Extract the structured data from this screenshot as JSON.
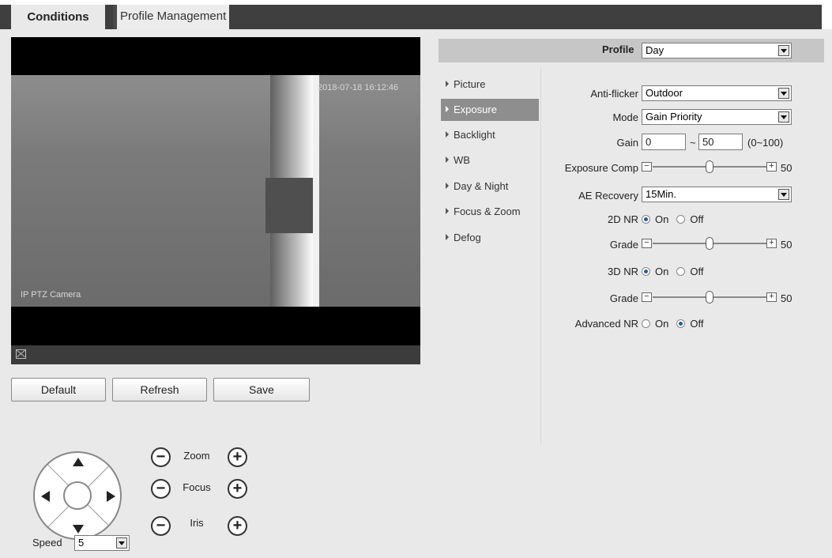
{
  "tabs": [
    {
      "label": "Conditions",
      "active": true
    },
    {
      "label": "Profile Management",
      "active": false
    }
  ],
  "video": {
    "timestamp": "2018-07-18 16:12:46",
    "camera_name": "IP PTZ Camera"
  },
  "actions": {
    "default_label": "Default",
    "refresh_label": "Refresh",
    "save_label": "Save"
  },
  "ptz": {
    "zoom_label": "Zoom",
    "focus_label": "Focus",
    "iris_label": "Iris",
    "minus_symbol": "−",
    "plus_symbol": "+",
    "speed_label": "Speed",
    "speed_value": "5"
  },
  "profile": {
    "label": "Profile",
    "value": "Day"
  },
  "menu": [
    {
      "label": "Picture",
      "active": false
    },
    {
      "label": "Exposure",
      "active": true
    },
    {
      "label": "Backlight",
      "active": false
    },
    {
      "label": "WB",
      "active": false
    },
    {
      "label": "Day & Night",
      "active": false
    },
    {
      "label": "Focus & Zoom",
      "active": false
    },
    {
      "label": "Defog",
      "active": false
    }
  ],
  "exposure": {
    "anti_flicker": {
      "label": "Anti-flicker",
      "value": "Outdoor"
    },
    "mode": {
      "label": "Mode",
      "value": "Gain Priority"
    },
    "gain": {
      "label": "Gain",
      "min": "0",
      "separator": "~",
      "max": "50",
      "range": "(0~100)"
    },
    "exposure_comp": {
      "label": "Exposure Comp",
      "value": "50",
      "level": 0.5
    },
    "ae_recovery": {
      "label": "AE Recovery",
      "value": "15Min."
    },
    "nr_2d": {
      "label": "2D NR",
      "on_label": "On",
      "off_label": "Off",
      "selected": "On"
    },
    "grade_2d": {
      "label": "Grade",
      "value": "50",
      "level": 0.5
    },
    "nr_3d": {
      "label": "3D NR",
      "on_label": "On",
      "off_label": "Off",
      "selected": "On"
    },
    "grade_3d": {
      "label": "Grade",
      "value": "50",
      "level": 0.5
    },
    "advanced_nr": {
      "label": "Advanced NR",
      "on_label": "On",
      "off_label": "Off",
      "selected": "Off"
    }
  },
  "colors": {
    "tabstrip": "#3f3f3f",
    "active_menu": "#8e8e8e",
    "radio_selected": "#1d5fa8"
  }
}
